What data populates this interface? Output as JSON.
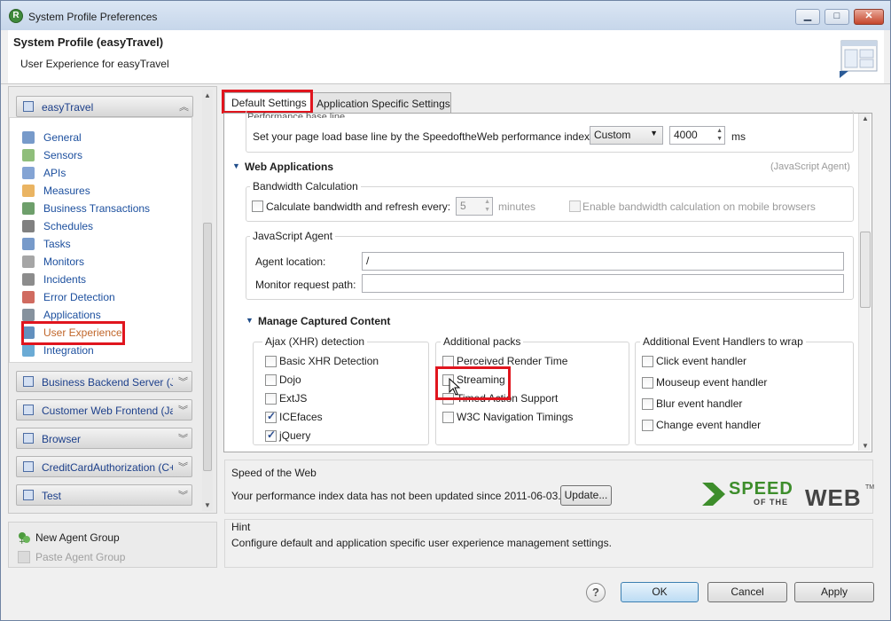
{
  "window": {
    "title": "System Profile Preferences"
  },
  "header": {
    "title": "System Profile (easyTravel)",
    "subtitle": "User Experience for easyTravel"
  },
  "nav": {
    "top_group": "easyTravel",
    "items": [
      {
        "label": "General",
        "icon": "general-icon",
        "color": "#4a78b8"
      },
      {
        "label": "Sensors",
        "icon": "sensors-icon",
        "color": "#6aa84f"
      },
      {
        "label": "APIs",
        "icon": "apis-icon",
        "color": "#5b86c5"
      },
      {
        "label": "Measures",
        "icon": "measures-icon",
        "color": "#e39b2e"
      },
      {
        "label": "Business Transactions",
        "icon": "business-transactions-icon",
        "color": "#3d7f3a"
      },
      {
        "label": "Schedules",
        "icon": "schedules-icon",
        "color": "#555555"
      },
      {
        "label": "Tasks",
        "icon": "tasks-icon",
        "color": "#4a78b8"
      },
      {
        "label": "Monitors",
        "icon": "monitors-icon",
        "color": "#888888"
      },
      {
        "label": "Incidents",
        "icon": "incidents-icon",
        "color": "#666666"
      },
      {
        "label": "Error Detection",
        "icon": "error-detection-icon",
        "color": "#c0392b"
      },
      {
        "label": "Applications",
        "icon": "applications-icon",
        "color": "#5d6d7e"
      },
      {
        "label": "User Experience",
        "icon": "user-experience-icon",
        "color": "#2e6ba8"
      },
      {
        "label": "Integration",
        "icon": "integration-icon",
        "color": "#3a8fc7"
      }
    ],
    "groups": [
      "Business Backend Server (Java)",
      "Customer Web Frontend (Java)",
      "Browser",
      "CreditCardAuthorization (C++)",
      "Test"
    ],
    "new_agent_group": "New Agent Group",
    "paste_agent_group": "Paste Agent Group"
  },
  "tabs": {
    "default": "Default Settings",
    "app_specific": "Application Specific Settings"
  },
  "perf": {
    "cut_label": "Performance base line",
    "text": "Set your page load base line by the SpeedoftheWeb performance index:",
    "select": "Custom",
    "value": "4000",
    "unit": "ms"
  },
  "web_apps": {
    "title": "Web Applications",
    "agent_note": "(JavaScript Agent)",
    "bandwidth": {
      "legend": "Bandwidth Calculation",
      "calc_label": "Calculate bandwidth and refresh every:",
      "minutes_value": "5",
      "minutes_unit": "minutes",
      "mobile_label": "Enable bandwidth calculation on mobile browsers"
    },
    "js_agent": {
      "legend": "JavaScript Agent",
      "location_label": "Agent location:",
      "location_value": "/",
      "monitor_label": "Monitor request path:",
      "monitor_value": ""
    }
  },
  "captured": {
    "title": "Manage Captured Content",
    "ajax": {
      "legend": "Ajax (XHR) detection",
      "items": [
        {
          "label": "Basic XHR Detection",
          "checked": false
        },
        {
          "label": "Dojo",
          "checked": false
        },
        {
          "label": "ExtJS",
          "checked": false
        },
        {
          "label": "ICEfaces",
          "checked": true
        },
        {
          "label": "jQuery",
          "checked": true
        }
      ]
    },
    "packs": {
      "legend": "Additional packs",
      "items": [
        {
          "label": "Perceived Render Time",
          "checked": false
        },
        {
          "label": "Streaming",
          "checked": false
        },
        {
          "label": "Timed Action Support",
          "checked": false
        },
        {
          "label": "W3C Navigation Timings",
          "checked": false
        }
      ]
    },
    "handlers": {
      "legend": "Additional Event Handlers to wrap",
      "items": [
        {
          "label": "Click event handler",
          "checked": false
        },
        {
          "label": "Mouseup event handler",
          "checked": false
        },
        {
          "label": "Blur event handler",
          "checked": false
        },
        {
          "label": "Change event handler",
          "checked": false
        }
      ]
    }
  },
  "speed": {
    "title": "Speed of the Web",
    "text": "Your performance index data has not been updated since 2011-06-03.",
    "update_button": "Update...",
    "logo_top": "SPEED",
    "logo_of_the": "OF THE",
    "logo_web": "WEB",
    "logo_tm": "TM"
  },
  "hint": {
    "title": "Hint",
    "text": "Configure default and application specific user experience management settings."
  },
  "buttons": {
    "help": "?",
    "ok": "OK",
    "cancel": "Cancel",
    "apply": "Apply"
  },
  "colors": {
    "highlight_red": "#e0151e",
    "nav_link": "#1c4f9e",
    "logo_green": "#3d8d2b"
  }
}
